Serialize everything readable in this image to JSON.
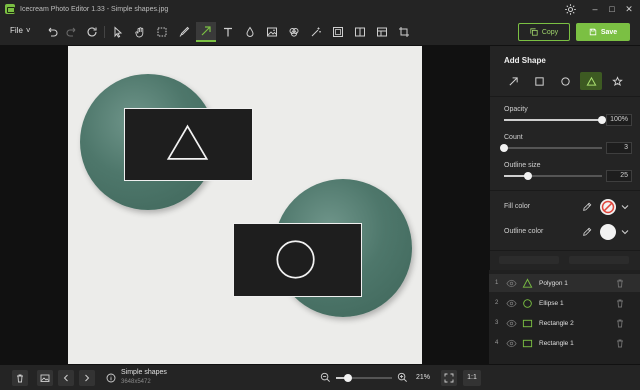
{
  "window": {
    "title": "Icecream Photo Editor 1.33 - Simple shapes.jpg",
    "controls": [
      "minimize",
      "maximize",
      "close"
    ]
  },
  "toolbar": {
    "file_label": "File",
    "tools": [
      "undo",
      "redo",
      "reset",
      "select",
      "hand",
      "selection",
      "brush",
      "arrow",
      "text",
      "drop",
      "image",
      "fill",
      "magic",
      "crop-frame",
      "split",
      "layout",
      "crop"
    ],
    "active_tool": "arrow",
    "copy_label": "Copy",
    "save_label": "Save"
  },
  "panel": {
    "title": "Add Shape",
    "shapes": [
      "arrow",
      "rectangle",
      "ellipse",
      "triangle",
      "star"
    ],
    "active_shape": "triangle",
    "opacity": {
      "label": "Opacity",
      "value": "100%",
      "level": 1.0
    },
    "count": {
      "label": "Count",
      "value": "3",
      "level": 0.0
    },
    "outline_size": {
      "label": "Outline size",
      "value": "25",
      "level": 0.24
    },
    "fill_color": {
      "label": "Fill color",
      "swatch": "none"
    },
    "outline_color": {
      "label": "Outline color",
      "swatch": "#f2f2f2"
    }
  },
  "layers": [
    {
      "num": "1",
      "name": "Polygon 1",
      "icon": "triangle-icon"
    },
    {
      "num": "2",
      "name": "Ellipse 1",
      "icon": "circle-icon"
    },
    {
      "num": "3",
      "name": "Rectangle 2",
      "icon": "rectangle-icon"
    },
    {
      "num": "4",
      "name": "Rectangle 1",
      "icon": "rectangle-icon"
    }
  ],
  "bottom": {
    "file_name": "Simple shapes",
    "file_dims": "3648x5472",
    "zoom": "21%",
    "zoom_level": 0.21,
    "actual_size": "1:1"
  },
  "colors": {
    "accent": "#7bc043",
    "background": "#1b1b1b",
    "panel": "#242424"
  }
}
